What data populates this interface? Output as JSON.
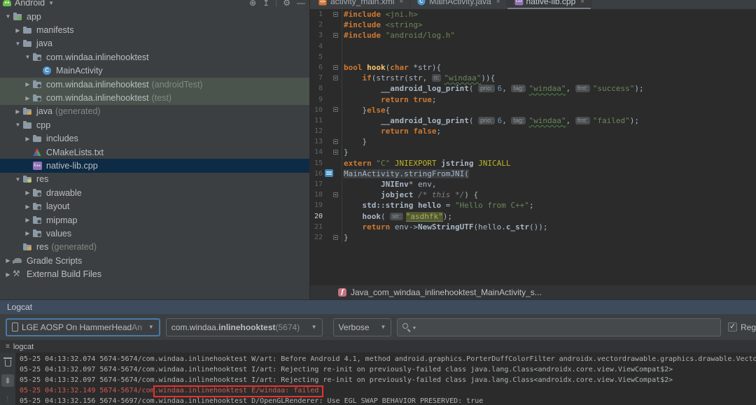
{
  "project": {
    "view_label": "Android",
    "toolbar_icons": [
      {
        "name": "locate-icon",
        "glyph": "⊕"
      },
      {
        "name": "collapse-all-icon",
        "glyph": "↥"
      },
      {
        "name": "divider",
        "glyph": ""
      },
      {
        "name": "settings-gear-icon",
        "glyph": "⚙"
      },
      {
        "name": "hide-panel-icon",
        "glyph": "—"
      }
    ],
    "items": [
      {
        "label": "app",
        "icon": "folder-app",
        "level": 0,
        "arrow": "open"
      },
      {
        "label": "manifests",
        "icon": "folder",
        "level": 1,
        "arrow": "closed"
      },
      {
        "label": "java",
        "icon": "folder",
        "level": 1,
        "arrow": "open"
      },
      {
        "label": "com.windaa.inlinehooktest",
        "icon": "package",
        "level": 2,
        "arrow": "open"
      },
      {
        "label": "MainActivity",
        "icon": "class",
        "level": 3,
        "arrow": "none"
      },
      {
        "label": "com.windaa.inlinehooktest",
        "suffix": " (androidTest)",
        "icon": "package",
        "level": 2,
        "arrow": "closed",
        "state": "hl"
      },
      {
        "label": "com.windaa.inlinehooktest",
        "suffix": " (test)",
        "icon": "package",
        "level": 2,
        "arrow": "closed",
        "state": "hl"
      },
      {
        "label": "java",
        "suffix": " (generated)",
        "icon": "folder-gen",
        "level": 1,
        "arrow": "closed"
      },
      {
        "label": "cpp",
        "icon": "folder",
        "level": 1,
        "arrow": "open"
      },
      {
        "label": "includes",
        "icon": "folder",
        "level": 2,
        "arrow": "closed"
      },
      {
        "label": "CMakeLists.txt",
        "icon": "cmake",
        "level": 2,
        "arrow": "none"
      },
      {
        "label": "native-lib.cpp",
        "icon": "cppfile",
        "level": 2,
        "arrow": "none",
        "state": "sel"
      },
      {
        "label": "res",
        "icon": "folder-res",
        "level": 1,
        "arrow": "open"
      },
      {
        "label": "drawable",
        "icon": "package",
        "level": 2,
        "arrow": "closed"
      },
      {
        "label": "layout",
        "icon": "package",
        "level": 2,
        "arrow": "closed"
      },
      {
        "label": "mipmap",
        "icon": "package",
        "level": 2,
        "arrow": "closed"
      },
      {
        "label": "values",
        "icon": "package",
        "level": 2,
        "arrow": "closed"
      },
      {
        "label": "res",
        "suffix": " (generated)",
        "icon": "folder-gen",
        "level": 1,
        "arrow": "none"
      },
      {
        "label": "Gradle Scripts",
        "icon": "gradle",
        "level": 0,
        "arrow": "closed"
      },
      {
        "label": "External Build Files",
        "icon": "wrench",
        "level": 0,
        "arrow": "closed"
      }
    ]
  },
  "editor": {
    "tabs": [
      {
        "label": "activity_main.xml",
        "icon": "xmlfile",
        "active": false
      },
      {
        "label": "MainActivity.java",
        "icon": "class",
        "active": false
      },
      {
        "label": "native-lib.cpp",
        "icon": "cppfile",
        "active": true
      }
    ],
    "close_glyph": "×",
    "footer_icon": "f",
    "footer_text": "Java_com_windaa_inlinehooktest_MainActivity_s...",
    "lines": [
      {
        "n": 1,
        "g": "m",
        "tokens": [
          [
            "kw",
            "#include"
          ],
          [
            "t",
            " "
          ],
          [
            "str",
            "<jni.h>"
          ]
        ]
      },
      {
        "n": 2,
        "tokens": [
          [
            "kw",
            "#include"
          ],
          [
            "t",
            " "
          ],
          [
            "str",
            "<string>"
          ]
        ]
      },
      {
        "n": 3,
        "g": "m",
        "tokens": [
          [
            "kw",
            "#include"
          ],
          [
            "t",
            " "
          ],
          [
            "str",
            "\"android/log.h\""
          ]
        ]
      },
      {
        "n": 4,
        "tokens": []
      },
      {
        "n": 5,
        "tokens": []
      },
      {
        "n": 6,
        "g": "m",
        "tokens": [
          [
            "kw",
            "bool"
          ],
          [
            "t",
            " "
          ],
          [
            "fn",
            "hook"
          ],
          [
            "t",
            "("
          ],
          [
            "kw",
            "char"
          ],
          [
            "t",
            " *str){"
          ]
        ]
      },
      {
        "n": 7,
        "g": "m",
        "tokens": [
          [
            "t",
            "    "
          ],
          [
            "kw",
            "if"
          ],
          [
            "t",
            "(strstr(str, "
          ],
          [
            "hint",
            "n:"
          ],
          [
            "stru",
            "\"windaa\""
          ],
          [
            "t",
            ")){"
          ]
        ]
      },
      {
        "n": 8,
        "tokens": [
          [
            "t",
            "        "
          ],
          [
            "b",
            "__android_log_print"
          ],
          [
            "t",
            "( "
          ],
          [
            "hint",
            "prio:"
          ],
          [
            "num",
            "6"
          ],
          [
            "t",
            ", "
          ],
          [
            "hint",
            "tag:"
          ],
          [
            "stru",
            "\"windaa\""
          ],
          [
            "t",
            ", "
          ],
          [
            "hint",
            "fmt:"
          ],
          [
            "str",
            "\"success\""
          ],
          [
            "t",
            ");"
          ]
        ]
      },
      {
        "n": 9,
        "tokens": [
          [
            "t",
            "        "
          ],
          [
            "kw",
            "return true"
          ],
          [
            "t",
            ";"
          ]
        ]
      },
      {
        "n": 10,
        "g": "m",
        "tokens": [
          [
            "t",
            "    }"
          ],
          [
            "kw",
            "else"
          ],
          [
            "t",
            "{"
          ]
        ]
      },
      {
        "n": 11,
        "tokens": [
          [
            "t",
            "        "
          ],
          [
            "b",
            "__android_log_print"
          ],
          [
            "t",
            "( "
          ],
          [
            "hint",
            "prio:"
          ],
          [
            "num",
            "6"
          ],
          [
            "t",
            ", "
          ],
          [
            "hint",
            "tag:"
          ],
          [
            "stru",
            "\"windaa\""
          ],
          [
            "t",
            ", "
          ],
          [
            "hint",
            "fmt:"
          ],
          [
            "str",
            "\"failed\""
          ],
          [
            "t",
            ");"
          ]
        ]
      },
      {
        "n": 12,
        "tokens": [
          [
            "t",
            "        "
          ],
          [
            "kw",
            "return false"
          ],
          [
            "t",
            ";"
          ]
        ]
      },
      {
        "n": 13,
        "g": "m",
        "tokens": [
          [
            "t",
            "    }"
          ]
        ]
      },
      {
        "n": 14,
        "g": "m",
        "tokens": [
          [
            "t",
            "}"
          ]
        ]
      },
      {
        "n": 15,
        "tokens": [
          [
            "kw",
            "extern"
          ],
          [
            "t",
            " "
          ],
          [
            "str",
            "\"C\""
          ],
          [
            "t",
            " "
          ],
          [
            "mac",
            "JNIEXPORT"
          ],
          [
            "t",
            " "
          ],
          [
            "b",
            "jstring"
          ],
          [
            "t",
            " "
          ],
          [
            "mac",
            "JNICALL"
          ]
        ]
      },
      {
        "n": 16,
        "g": "cpp",
        "tokens": [
          [
            "fold",
            "MainActivity.stringFromJNI("
          ]
        ]
      },
      {
        "n": 17,
        "tokens": [
          [
            "t",
            "        "
          ],
          [
            "b",
            "JNIEnv"
          ],
          [
            "t",
            "* env,"
          ]
        ]
      },
      {
        "n": 18,
        "g": "m",
        "tokens": [
          [
            "t",
            "        "
          ],
          [
            "b",
            "jobject"
          ],
          [
            "t",
            " "
          ],
          [
            "cmt",
            "/* this */"
          ],
          [
            "t",
            ") {"
          ]
        ]
      },
      {
        "n": 19,
        "tokens": [
          [
            "t",
            "    "
          ],
          [
            "b",
            "std::string hello"
          ],
          [
            "t",
            " = "
          ],
          [
            "str",
            "\"Hello from C++\""
          ],
          [
            "t",
            ";"
          ]
        ]
      },
      {
        "n": 20,
        "cur": true,
        "tokens": [
          [
            "t",
            "    "
          ],
          [
            "b",
            "hook"
          ],
          [
            "t",
            "( "
          ],
          [
            "hint",
            "str:"
          ],
          [
            "hl",
            "\"asdhfk\""
          ],
          [
            "t",
            ");"
          ]
        ]
      },
      {
        "n": 21,
        "tokens": [
          [
            "t",
            "    "
          ],
          [
            "kw",
            "return"
          ],
          [
            "t",
            " env->"
          ],
          [
            "b",
            "NewStringUTF"
          ],
          [
            "t",
            "(hello."
          ],
          [
            "b",
            "c_str"
          ],
          [
            "t",
            "());"
          ]
        ]
      },
      {
        "n": 22,
        "g": "m",
        "tokens": [
          [
            "t",
            "}"
          ]
        ]
      }
    ]
  },
  "logcat": {
    "title": "Logcat",
    "device_label": "LGE AOSP On HammerHead ",
    "device_label_dim": "An",
    "process_prefix": "com.windaa.",
    "process_bold": "inlinehooktest",
    "process_dim": " (5674)",
    "level": "Verbose",
    "search_value": "",
    "regex_label": "Reg",
    "tab_label": "logcat",
    "lines": [
      {
        "level": "W",
        "text": "05-25 04:13:32.074 5674-5674/com.windaa.inlinehooktest W/art: Before Android 4.1, method android.graphics.PorterDuffColorFilter androidx.vectordrawable.graphics.drawable.VectorDr"
      },
      {
        "level": "I",
        "text": "05-25 04:13:32.097 5674-5674/com.windaa.inlinehooktest I/art: Rejecting re-init on previously-failed class java.lang.Class<androidx.core.view.ViewCompat$2>"
      },
      {
        "level": "I",
        "text": "05-25 04:13:32.097 5674-5674/com.windaa.inlinehooktest I/art: Rejecting re-init on previously-failed class java.lang.Class<androidx.core.view.ViewCompat$2>"
      },
      {
        "level": "E",
        "text": "05-25 04:13:32.149 5674-5674/com.windaa.inlinehooktest E/windaa: failed"
      },
      {
        "level": "D",
        "text": "05-25 04:13:32.156 5674-5697/com.windaa.inlinehooktest D/OpenGLRenderer: Use EGL SWAP BEHAVIOR PRESERVED: true"
      }
    ]
  },
  "colors": {
    "annotation_box": "#E8322C",
    "error_line": "#CF5B56",
    "selection_bg": "#0D2B45",
    "test_highlight_bg": "#4A544D",
    "focus_border": "#4879A8"
  }
}
